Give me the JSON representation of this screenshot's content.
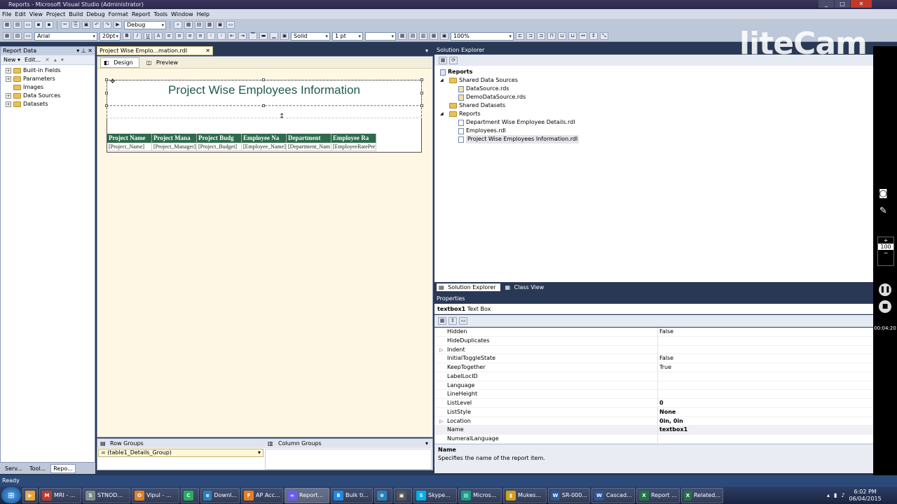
{
  "window": {
    "title": "Reports - Microsoft Visual Studio (Administrator)"
  },
  "menu": [
    "File",
    "Edit",
    "View",
    "Project",
    "Build",
    "Debug",
    "Format",
    "Report",
    "Tools",
    "Window",
    "Help"
  ],
  "toolbar": {
    "config": "Debug",
    "font": "Arial",
    "size": "20pt",
    "border_style": "Solid",
    "border_width": "1 pt",
    "zoom": "100%"
  },
  "report_data": {
    "title": "Report Data",
    "new_label": "New",
    "edit_label": "Edit...",
    "items": [
      "Built-in Fields",
      "Parameters",
      "Images",
      "Data Sources",
      "Datasets"
    ]
  },
  "left_tabs": [
    "Serv...",
    "Tool...",
    "Repo..."
  ],
  "document": {
    "tab": "Project Wise Emplo...mation.rdl [Design]*",
    "design_tab": "Design",
    "preview_tab": "Preview",
    "report_title": "Project Wise Employees Information",
    "headers": [
      "Project Name",
      "Project Mana",
      "Project Budg",
      "Employee Na",
      "Department",
      "Employee Ra"
    ],
    "row": [
      "[Project_Name]",
      "[Project_Manager]",
      "[Project_Budget]",
      "[Employee_Name]",
      "[Department_Nam",
      "[EmployeeRatePer"
    ]
  },
  "grouping": {
    "row_groups": "Row Groups",
    "column_groups": "Column Groups",
    "row_group_item": "= (table1_Details_Group)"
  },
  "solution_explorer": {
    "title": "Solution Explorer",
    "root": "Reports",
    "shared_data_sources": "Shared Data Sources",
    "data_sources": [
      "DataSource.rds",
      "DemoDataSource.rds"
    ],
    "shared_datasets": "Shared Datasets",
    "reports_folder": "Reports",
    "reports": [
      "Department Wise Employee Details.rdl",
      "Employees.rdl",
      "Project Wise Employees Information.rdl"
    ]
  },
  "bottom_tabs": {
    "solution_explorer": "Solution Explorer",
    "class_view": "Class View"
  },
  "properties": {
    "title": "Properties",
    "object_name": "textbox1",
    "object_type": "Text Box",
    "rows": [
      {
        "name": "Hidden",
        "value": "False",
        "bold": false,
        "expand": false
      },
      {
        "name": "HideDuplicates",
        "value": "",
        "bold": false,
        "expand": false
      },
      {
        "name": "Indent",
        "value": "",
        "bold": false,
        "expand": true
      },
      {
        "name": "InitialToggleState",
        "value": "False",
        "bold": false,
        "expand": false
      },
      {
        "name": "KeepTogether",
        "value": "True",
        "bold": false,
        "expand": false
      },
      {
        "name": "LabelLocID",
        "value": "",
        "bold": false,
        "expand": false
      },
      {
        "name": "Language",
        "value": "",
        "bold": false,
        "expand": false
      },
      {
        "name": "LineHeight",
        "value": "",
        "bold": false,
        "expand": false
      },
      {
        "name": "ListLevel",
        "value": "0",
        "bold": true,
        "expand": false
      },
      {
        "name": "ListStyle",
        "value": "None",
        "bold": true,
        "expand": false
      },
      {
        "name": "Location",
        "value": "0in, 0in",
        "bold": true,
        "expand": true
      },
      {
        "name": "Name",
        "value": "textbox1",
        "bold": true,
        "expand": false
      },
      {
        "name": "NumeralLanguage",
        "value": "",
        "bold": false,
        "expand": false
      }
    ],
    "desc_title": "Name",
    "desc_text": "Specifies the name of the report item."
  },
  "status": "Ready",
  "taskbar": [
    {
      "label": "MRI - ...",
      "color": "#c0392b",
      "icon": "M"
    },
    {
      "label": "STNOD...",
      "color": "#7f8c8d",
      "icon": "S"
    },
    {
      "label": "Vipul - ...",
      "color": "#e67e22",
      "icon": "O"
    },
    {
      "label": "",
      "color": "#27ae60",
      "icon": "C"
    },
    {
      "label": "Downl...",
      "color": "#2980b9",
      "icon": "e"
    },
    {
      "label": "AP Acc...",
      "color": "#e67e22",
      "icon": "F"
    },
    {
      "label": "Report...",
      "color": "#6c5ce7",
      "icon": "∞"
    },
    {
      "label": "Bulk ti...",
      "color": "#1e88e5",
      "icon": "B"
    },
    {
      "label": "",
      "color": "#2980b9",
      "icon": "⊕"
    },
    {
      "label": "",
      "color": "#555",
      "icon": "▣"
    },
    {
      "label": "Skype...",
      "color": "#00aff0",
      "icon": "S"
    },
    {
      "label": "Micros...",
      "color": "#16a085",
      "icon": "▤"
    },
    {
      "label": "Mukes...",
      "color": "#d4a017",
      "icon": "▮"
    },
    {
      "label": "SR-000...",
      "color": "#2b579a",
      "icon": "W"
    },
    {
      "label": "Cascad...",
      "color": "#2b579a",
      "icon": "W"
    },
    {
      "label": "Report ...",
      "color": "#217346",
      "icon": "X"
    },
    {
      "label": "Related...",
      "color": "#217346",
      "icon": "X"
    }
  ],
  "clock": {
    "time": "6:02 PM",
    "date": "06/04/2015"
  },
  "overlay": {
    "brand": "liteCam",
    "zoom": "100",
    "timer": "00:04:20"
  }
}
